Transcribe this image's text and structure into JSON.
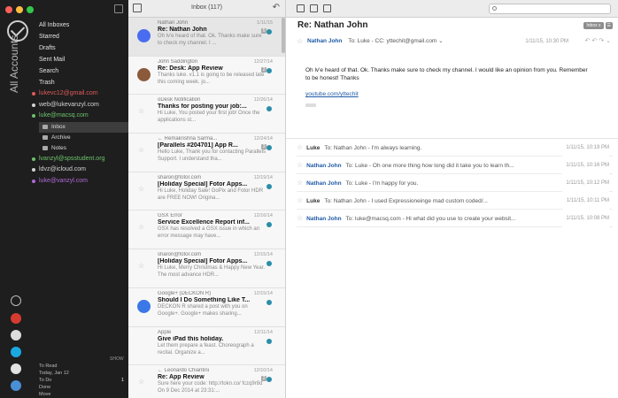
{
  "sidebar": {
    "vertical_label": "All Accounts",
    "nav": [
      "All Inboxes",
      "Starred",
      "Drafts",
      "Sent Mail",
      "Search",
      "Trash"
    ],
    "accounts": [
      {
        "email": "lukevc12@gmail.com",
        "color": "#e05a5a"
      },
      {
        "email": "web@lukevanzyl.com",
        "color": "#d4d4d4"
      },
      {
        "email": "luke@macsq.com",
        "color": "#6dc36d"
      }
    ],
    "folders": [
      "Inbox",
      "Archive",
      "Notes"
    ],
    "accounts2": [
      {
        "email": "lvanzyl@spsstudent.org",
        "color": "#6dc36d"
      },
      {
        "email": "ldvz@icloud.com",
        "color": "#d4d4d4"
      },
      {
        "email": "luke@vanzyl.com",
        "color": "#b06ad8"
      }
    ],
    "show_label": "SHOW",
    "bottom": {
      "to_read": "To Read",
      "today": "Today, Jan 12",
      "to_do": "To Do",
      "to_do_count": "1",
      "done": "Done",
      "more": "Move"
    }
  },
  "list": {
    "title": "Inbox (117)",
    "messages": [
      {
        "sender": "Nathan John",
        "subject": "Re: Nathan John",
        "preview": "Oh lv'e heard of that. Ok. Thanks make sure to check my channel. I ...",
        "date": "1/11/15",
        "count": "5",
        "avatar": "#4a6cf0",
        "selected": true
      },
      {
        "sender": "John Saddington",
        "subject": "Re: Desk: App Review",
        "preview": "Thanks luke. v1.1 is going to be released late this coming week. jo...",
        "date": "12/27/14",
        "count": "2",
        "avatar": "#8a5a3a",
        "selected": false
      },
      {
        "sender": "oDesk Notification",
        "subject": "Thanks for posting your job:...",
        "preview": "Hi Luke, You posted your first job! Once the applications st...",
        "date": "12/26/14",
        "count": "",
        "avatar": "",
        "selected": false
      },
      {
        "sender": "← Remakrishna Sarma...",
        "subject": "[Parallels #204701] App R...",
        "preview": "Hello Luke, Thank you for contacting Parallels Support. I understand tha...",
        "date": "12/24/14",
        "count": "3",
        "avatar": "",
        "selected": false
      },
      {
        "sender": "sharon@fotor.com",
        "subject": "[Holiday Special] Fotor Apps...",
        "preview": "Hi Luke, Holiday Sale! GoPix and Fotor HDR are FREE NOW! Origina...",
        "date": "12/19/14",
        "count": "",
        "avatar": "",
        "selected": false
      },
      {
        "sender": "GSX Error",
        "subject": "Service Excellence Report inf...",
        "preview": "GSX has resolved a GSX issue in which an error message may have...",
        "date": "12/16/14",
        "count": "",
        "avatar": "",
        "selected": false
      },
      {
        "sender": "sharon@fotor.com",
        "subject": "[Holiday Special] Fotor Apps...",
        "preview": "Hi Luke, Merry Christmas & Happy New Year. The most advance HDR...",
        "date": "12/15/14",
        "count": "",
        "avatar": "",
        "selected": false
      },
      {
        "sender": "Google+ (DECKON R)",
        "subject": "Should I Do Something Like T...",
        "preview": "DECKON R shared a post with you on Google+. Google+ makes sharing...",
        "date": "12/15/14",
        "count": "",
        "avatar": "#3b78e7",
        "selected": false
      },
      {
        "sender": "Apple",
        "subject": "Give iPad this holiday.",
        "preview": "Let them prepare a feast. Choreograph a recital. Organize a...",
        "date": "12/11/14",
        "count": "",
        "avatar": "#f7f7f7",
        "selected": false
      },
      {
        "sender": "← Leonardo Chiantini",
        "subject": "Re: App Review",
        "preview": "Sure here your code: http://tokn.co/ fczq9r8d On 9 Dec 2014 at 23:31:...",
        "date": "12/10/14",
        "count": "2",
        "avatar": "",
        "selected": false
      }
    ]
  },
  "thread": {
    "title": "Re: Nathan John",
    "tag": "Inbox",
    "tag_close": "x",
    "expanded": {
      "from": "Nathan John",
      "to": "To: Luke - CC: yttechit@gmail.com",
      "date": "1/11/15, 10:30 PM",
      "body": "Oh lv'e heard of that. Ok. Thanks make sure to check my channel. I would like an opinion from you. Remember to be honest! Thanks",
      "link": "youtube.com/yttechit"
    },
    "collapsed": [
      {
        "from": "Luke",
        "snip": "To: Nathan John - I'm always learning.",
        "date": "1/11/15, 10:19 PM",
        "dark": true
      },
      {
        "from": "Nathan John",
        "snip": "To: Luke - Oh one more thing how long did it take you to learn th...",
        "date": "1/11/15, 10:16 PM",
        "dark": false
      },
      {
        "from": "Nathan John",
        "snip": "To: Luke - I'm happy for you.",
        "date": "1/11/15, 10:12 PM",
        "dark": false
      },
      {
        "from": "Luke",
        "snip": "To: Nathan John - I used Expressioneinge mad custom coded/...",
        "date": "1/11/15, 10:11 PM",
        "dark": true
      },
      {
        "from": "Nathan John",
        "snip": "To: luke@macsq.com - Hi what did you use to create your websit...",
        "date": "1/11/15, 10:08 PM",
        "dark": false
      }
    ]
  }
}
